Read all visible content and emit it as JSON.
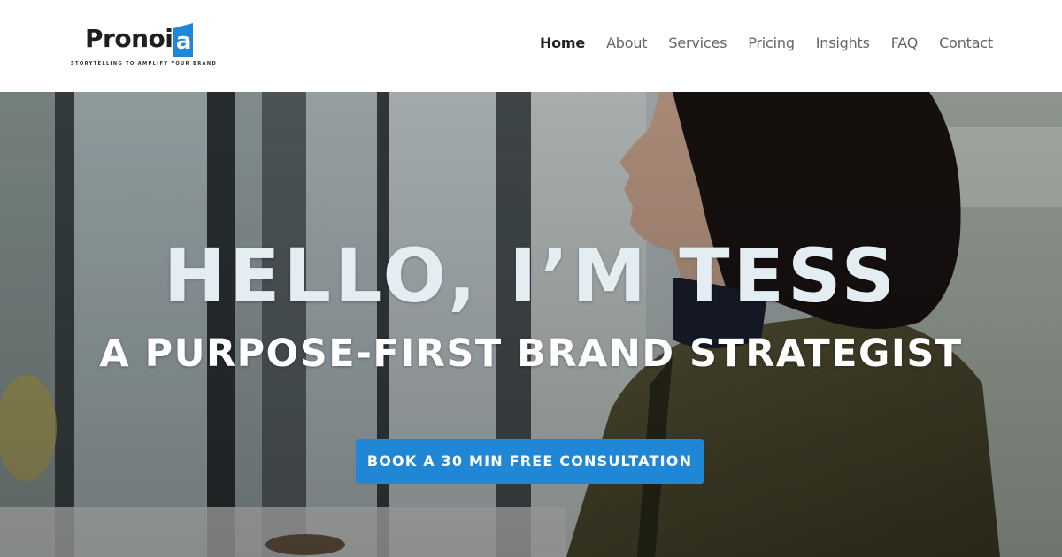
{
  "brand": {
    "name": "Pronoi",
    "name_accent_letter": "a",
    "tagline": "STORYTELLING TO AMPLIFY YOUR BRAND",
    "accent_color": "#1f87d6"
  },
  "nav": {
    "items": [
      {
        "label": "Home",
        "active": true
      },
      {
        "label": "About",
        "active": false
      },
      {
        "label": "Services",
        "active": false
      },
      {
        "label": "Pricing",
        "active": false
      },
      {
        "label": "Insights",
        "active": false
      },
      {
        "label": "FAQ",
        "active": false
      },
      {
        "label": "Contact",
        "active": false
      }
    ]
  },
  "hero": {
    "title": "HELLO, I’M TESS",
    "subtitle": "A PURPOSE-FIRST BRAND STRATEGIST",
    "cta_label": "BOOK A 30 MIN FREE CONSULTATION",
    "cta_color": "#1f87d6"
  }
}
